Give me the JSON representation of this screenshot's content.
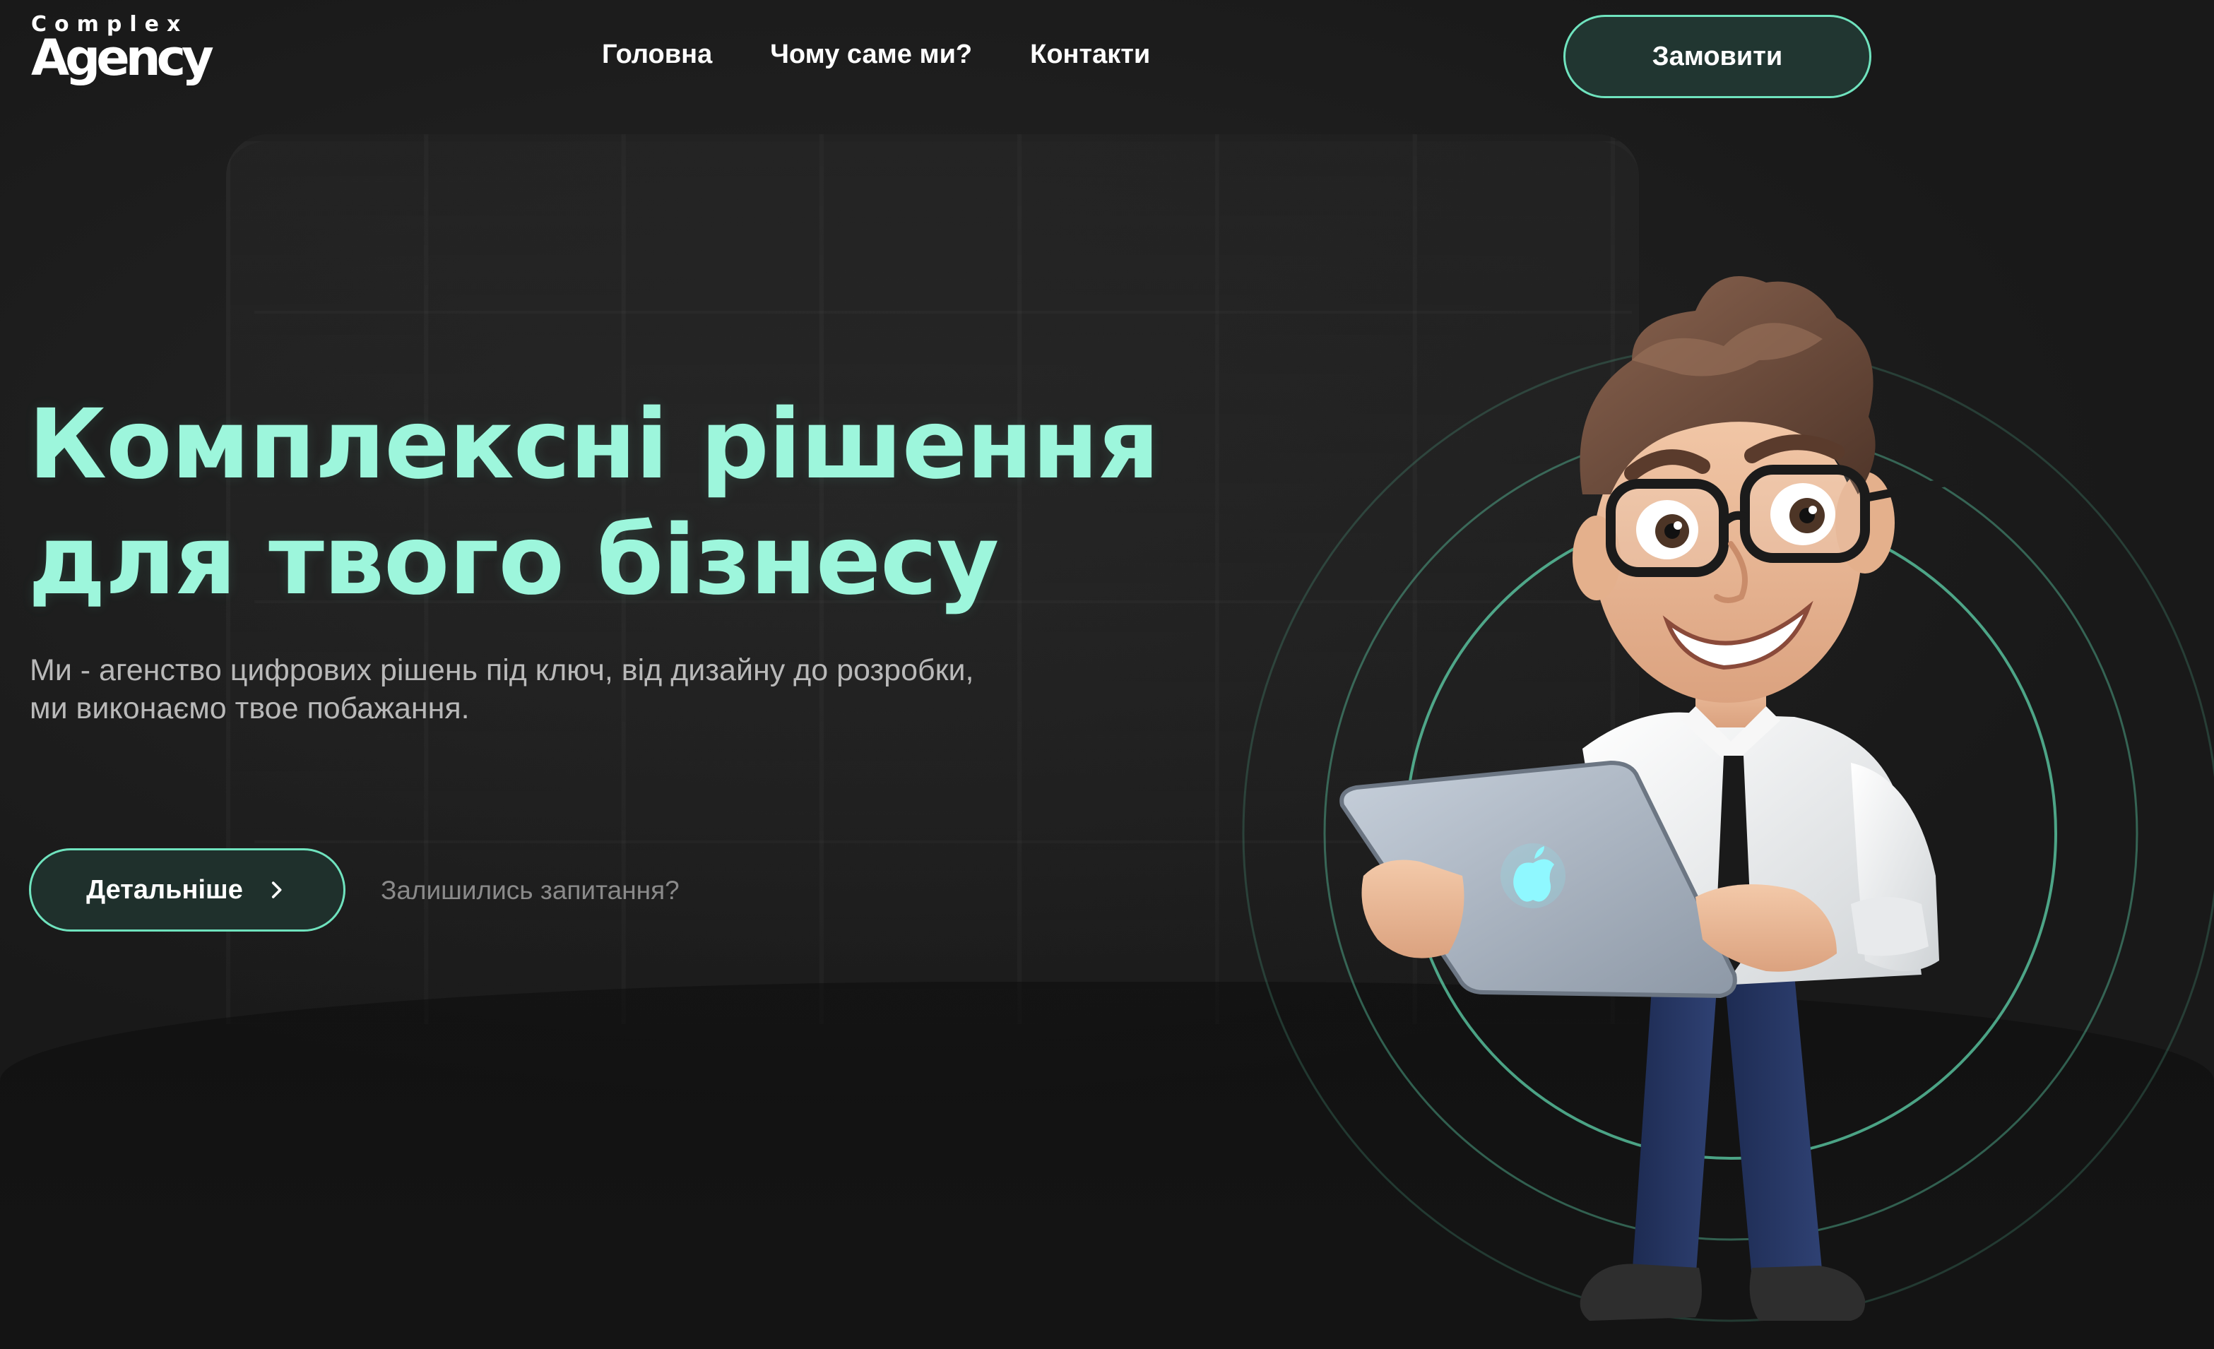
{
  "logo": {
    "small": "Complex",
    "big": "Agency"
  },
  "nav": {
    "items": [
      {
        "label": "Головна"
      },
      {
        "label": "Чому саме ми?"
      },
      {
        "label": "Контакти"
      }
    ],
    "order_button": "Замовити"
  },
  "hero": {
    "title_line1": "Комплексні рішення",
    "title_line2": "для твого бізнесу",
    "description": "Ми - агенство цифрових рішень під ключ, від дизайну до розробки, ми виконаємо твое побажання.",
    "details_button": "Детальніше",
    "questions_link": "Залишились запитання?"
  },
  "icons": {
    "details_button_icon": "chevron-right-icon",
    "tablet_logo": "apple-logo-icon"
  },
  "colors": {
    "background": "#1c1c1c",
    "accent": "#6fe3be",
    "title": "#9df6dc",
    "button_fill": "#213631",
    "muted_text": "#8a8a8a"
  }
}
